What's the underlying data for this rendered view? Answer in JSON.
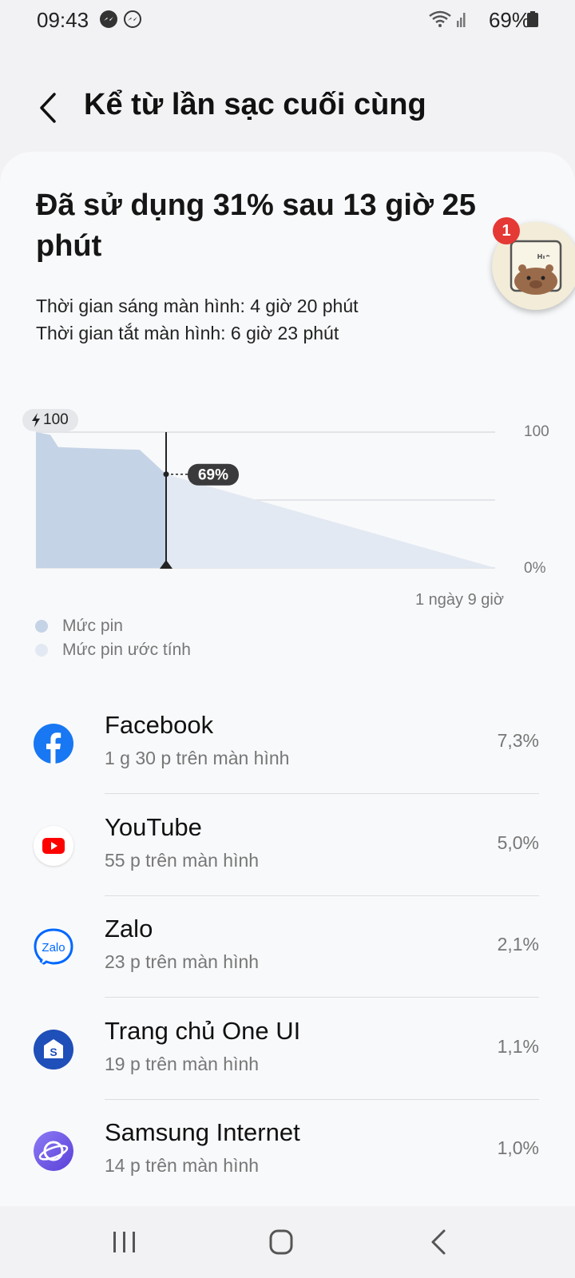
{
  "status": {
    "time": "09:43",
    "battery": "69%",
    "icons": [
      "messenger-icon",
      "messenger-icon",
      "wifi-icon",
      "signal-icon",
      "battery-icon"
    ]
  },
  "header": {
    "title": "Kể từ lần sạc cuối cùng",
    "back_icon": "back-icon"
  },
  "summary": {
    "title": "Đã sử dụng 31% sau 13 giờ 25 phút",
    "screen_on": "Thời gian sáng màn hình: 4 giờ 20 phút",
    "screen_off": "Thời gian tắt màn hình: 6 giờ 23 phút"
  },
  "floating_bubble": {
    "badge": "1"
  },
  "chart_data": {
    "type": "area",
    "charge_label": "100",
    "current_label": "69%",
    "y_ticks": [
      "100",
      "0%"
    ],
    "ylim": [
      0,
      100
    ],
    "x_end_label": "1 ngày 9 giờ",
    "series": [
      {
        "name": "Mức pin",
        "values": [
          100,
          98,
          89,
          88,
          87,
          69
        ]
      },
      {
        "name": "Mức pin ước tính",
        "values": [
          69,
          0
        ]
      }
    ],
    "grid": true,
    "colors": {
      "actual": "#c5d3e6",
      "estimated": "#e3e9f2"
    }
  },
  "legend": {
    "actual": "Mức pin",
    "estimated": "Mức pin ước tính"
  },
  "apps": [
    {
      "name": "Facebook",
      "sub": "1 g 30 p trên màn hình",
      "pct": "7,3%",
      "icon": "facebook-icon"
    },
    {
      "name": "YouTube",
      "sub": "55 p trên màn hình",
      "pct": "5,0%",
      "icon": "youtube-icon"
    },
    {
      "name": "Zalo",
      "sub": "23 p trên màn hình",
      "pct": "2,1%",
      "icon": "zalo-icon",
      "icon_text": "Zalo"
    },
    {
      "name": "Trang chủ One UI",
      "sub": "19 p trên màn hình",
      "pct": "1,1%",
      "icon": "one-ui-home-icon"
    },
    {
      "name": "Samsung Internet",
      "sub": "14 p trên màn hình",
      "pct": "1,0%",
      "icon": "samsung-internet-icon"
    }
  ],
  "nav": {
    "icons": [
      "recents-icon",
      "home-icon",
      "back-icon"
    ]
  }
}
